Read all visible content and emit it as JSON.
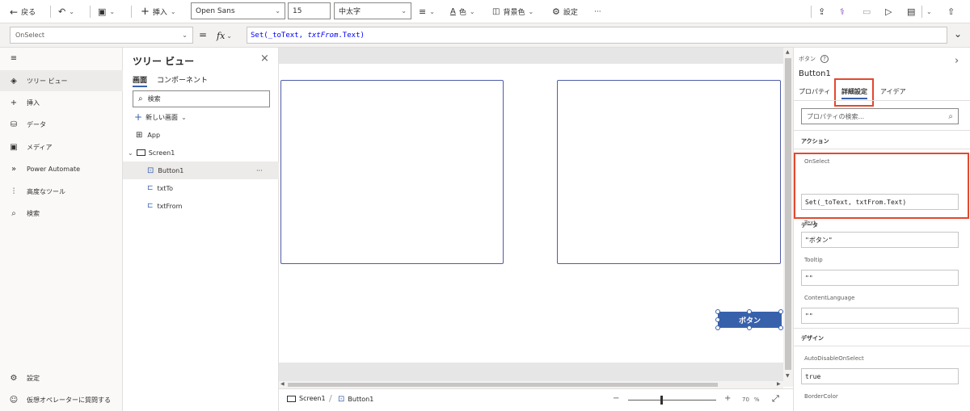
{
  "toolbar": {
    "back_label": "戻る",
    "insert_label": "挿入",
    "font_name": "Open Sans",
    "font_size": "15",
    "font_weight": "中太字",
    "color_label": "色",
    "fill_label": "背景色",
    "settings_label": "設定",
    "more_label": "···"
  },
  "formula_bar": {
    "property": "OnSelect",
    "equals": "=",
    "fx": "fx",
    "formula_prefix": "Set(_toText, ",
    "formula_italic": "txtFrom",
    "formula_suffix": ".Text)"
  },
  "left_nav": {
    "items": [
      {
        "label": "ツリー ビュー",
        "icon": "layers-icon"
      },
      {
        "label": "挿入",
        "icon": "plus-icon"
      },
      {
        "label": "データ",
        "icon": "database-icon"
      },
      {
        "label": "メディア",
        "icon": "media-icon"
      },
      {
        "label": "Power Automate",
        "icon": "flow-icon"
      },
      {
        "label": "高度なツール",
        "icon": "tools-icon"
      },
      {
        "label": "検索",
        "icon": "search-icon"
      }
    ],
    "bottom_items": [
      {
        "label": "設定",
        "icon": "gear-icon"
      },
      {
        "label": "仮想オペレーターに質問する",
        "icon": "agent-icon"
      }
    ]
  },
  "tree": {
    "title": "ツリー ビュー",
    "tab_screens": "画面",
    "tab_components": "コンポーネント",
    "search_placeholder": "検索",
    "new_screen": "新しい画面",
    "app": "App",
    "screen1": "Screen1",
    "button1": "Button1",
    "txtTo": "txtTo",
    "txtFrom": "txtFrom",
    "more": "···"
  },
  "canvas": {
    "button_label": "ボタン"
  },
  "status": {
    "screen": "Screen1",
    "button": "Button1",
    "zoom": "70",
    "zoom_unit": "%",
    "minus": "−",
    "plus": "+"
  },
  "props": {
    "type_label": "ボタン",
    "control_name": "Button1",
    "tab_properties": "プロパティ",
    "tab_advanced": "詳細設定",
    "tab_ideas": "アイデア",
    "search_placeholder": "プロパティの検索...",
    "section_action": "アクション",
    "onselect_label": "OnSelect",
    "onselect_value": "Set(_toText, txtFrom.Text)",
    "section_data": "データ",
    "text_label": "Text",
    "text_value": "\"ボタン\"",
    "tooltip_label": "Tooltip",
    "tooltip_value": "\"\"",
    "contentlang_label": "ContentLanguage",
    "contentlang_value": "\"\"",
    "section_design": "デザイン",
    "autodisable_label": "AutoDisableOnSelect",
    "autodisable_value": "true",
    "bordercolor_label": "BorderColor"
  },
  "colors": {
    "accent": "#3861ac",
    "highlight": "#e2492f"
  }
}
